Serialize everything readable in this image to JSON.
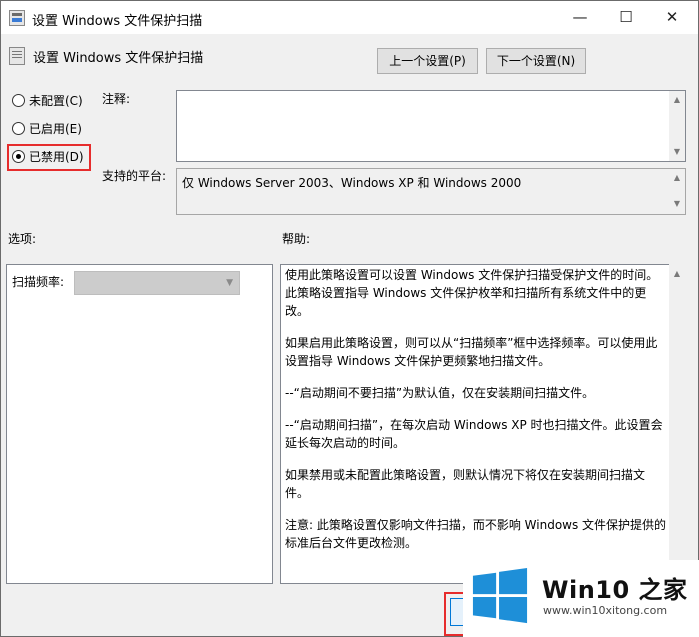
{
  "window": {
    "title": "设置 Windows 文件保护扫描",
    "minimize_glyph": "—",
    "maximize_glyph": "☐",
    "close_glyph": "✕"
  },
  "header": {
    "policy_title": "设置 Windows 文件保护扫描",
    "prev_label": "上一个设置(P)",
    "next_label": "下一个设置(N)"
  },
  "state": {
    "options": [
      {
        "label": "未配置(C)",
        "checked": false
      },
      {
        "label": "已启用(E)",
        "checked": false
      },
      {
        "label": "已禁用(D)",
        "checked": true
      }
    ],
    "selected": "已禁用(D)"
  },
  "comment": {
    "label": "注释:",
    "value": ""
  },
  "platform": {
    "label": "支持的平台:",
    "value": "仅 Windows Server 2003、Windows XP 和 Windows 2000"
  },
  "options_panel": {
    "label": "选项:",
    "scan_frequency_label": "扫描频率:",
    "scan_frequency_value": ""
  },
  "help_panel": {
    "label": "帮助:",
    "paragraphs": [
      "使用此策略设置可以设置 Windows 文件保护扫描受保护文件的时间。此策略设置指导 Windows 文件保护枚举和扫描所有系统文件中的更改。",
      "如果启用此策略设置，则可以从“扫描频率”框中选择频率。可以使用此设置指导 Windows 文件保护更频繁地扫描文件。",
      "--“启动期间不要扫描”为默认值，仅在安装期间扫描文件。",
      "--“启动期间扫描”，在每次启动 Windows XP 时也扫描文件。此设置会延长每次启动的时间。",
      "如果禁用或未配置此策略设置，则默认情况下将仅在安装期间扫描文件。",
      "注意: 此策略设置仅影响文件扫描，而不影响 Windows 文件保护提供的标准后台文件更改检测。"
    ]
  },
  "watermark": {
    "title": "Win10 之家",
    "url": "www.win10xitong.com",
    "flag_color": "#1e8fd8"
  }
}
